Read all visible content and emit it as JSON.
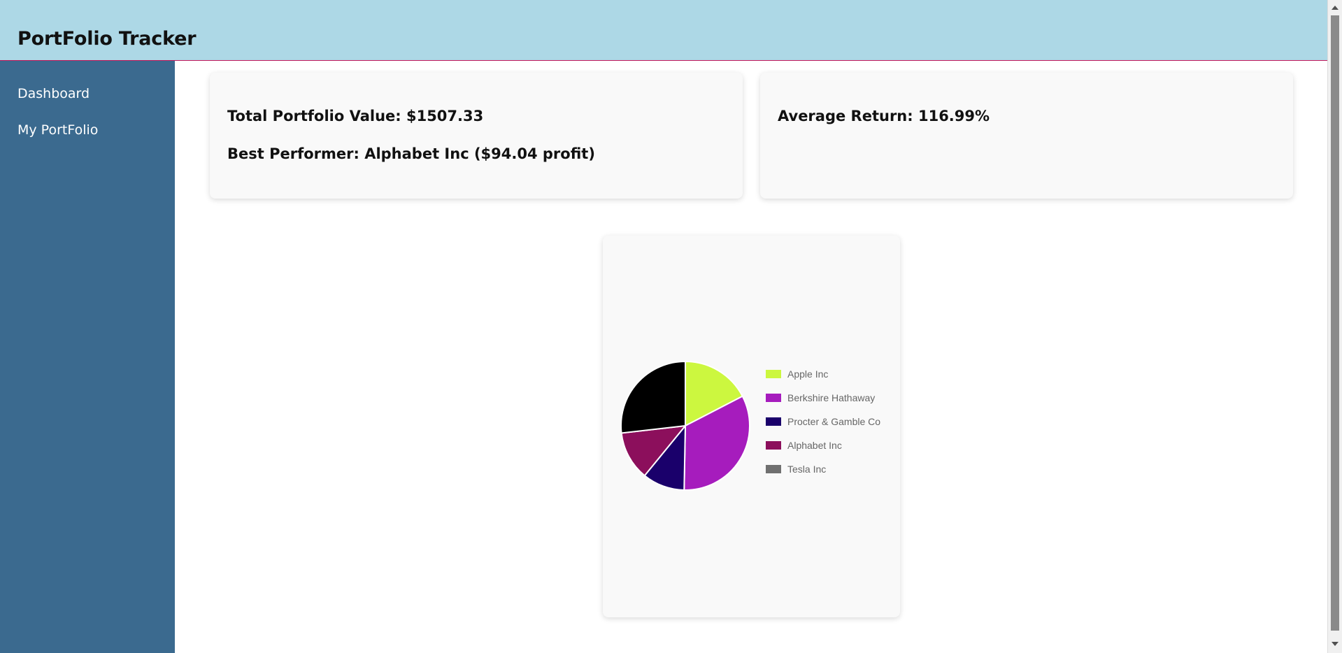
{
  "header": {
    "title": "PortFolio Tracker"
  },
  "sidebar": {
    "items": [
      {
        "label": "Dashboard"
      },
      {
        "label": "My PortFolio"
      }
    ]
  },
  "summary": {
    "total_value": "Total Portfolio Value: $1507.33",
    "best_performer": "Best Performer: Alphabet Inc ($94.04 profit)",
    "average_return": "Average Return: 116.99%"
  },
  "colors": {
    "header_bg": "#add8e6",
    "sidebar_bg": "#3b6a8f",
    "card_bg": "#f9f9f9"
  },
  "chart_data": {
    "type": "pie",
    "categories": [
      "Apple Inc",
      "Berkshire Hathaway",
      "Procter & Gamble Co",
      "Alphabet Inc",
      "Tesla Inc"
    ],
    "legend_labels": [
      "Apple Inc",
      "Berkshire Hathaway",
      "Procter & Gamble Co",
      "Alphabet Inc",
      "Tesla Inc"
    ],
    "values": [
      17.4,
      32.9,
      10.6,
      12.3,
      26.8
    ],
    "colors": [
      "#ccf73f",
      "#a61cbd",
      "#1a006b",
      "#8c0f5c",
      "#000000"
    ],
    "legend_swatch_colors": [
      "#ccf73f",
      "#a61cbd",
      "#1a006b",
      "#8c0f5c",
      "#707070"
    ],
    "legend_position": "right",
    "start_angle_deg": -90
  }
}
